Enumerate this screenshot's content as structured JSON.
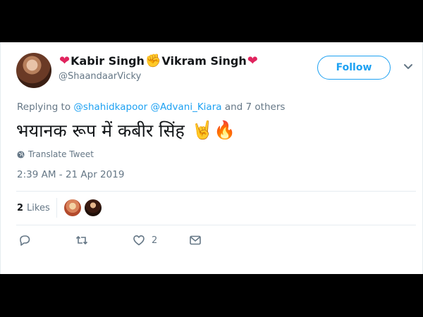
{
  "user": {
    "display_name_part1": "Kabir Singh",
    "display_name_part2": "Vikram Singh",
    "emoji_heart": "❤",
    "emoji_fist": "✊",
    "handle": "@ShaandaarVicky"
  },
  "follow_button": {
    "label": "Follow"
  },
  "reply_context": {
    "prefix": "Replying to",
    "mention1": "@shahidkapoor",
    "mention2": "@Advani_Kiara",
    "suffix": "and 7 others"
  },
  "tweet": {
    "text": "भयानक रूप में कबीर सिंह",
    "emojis": "🤘🔥",
    "translate_label": "Translate Tweet",
    "timestamp": "2:39 AM - 21 Apr 2019"
  },
  "stats": {
    "likes_count": "2",
    "likes_label": "Likes"
  },
  "actions": {
    "reply_icon": "reply-icon",
    "retweet_icon": "retweet-icon",
    "like_icon": "heart-icon",
    "like_count": "2",
    "dm_icon": "envelope-icon"
  },
  "colors": {
    "accent": "#1da1f2",
    "secondary_text": "#657786",
    "heart": "#e0245e"
  }
}
